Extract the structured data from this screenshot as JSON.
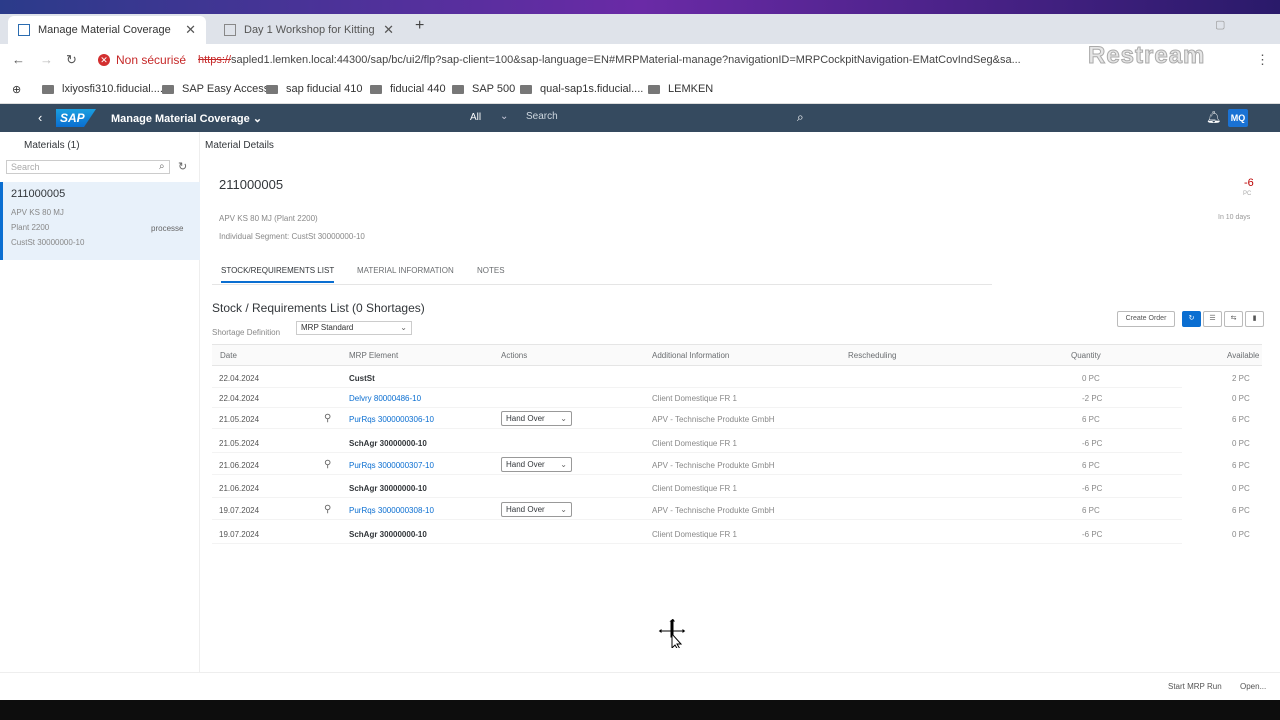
{
  "browser": {
    "tabs": [
      {
        "title": "Manage Material Coverage",
        "active": true
      },
      {
        "title": "Day 1 Workshop for Kitting",
        "active": false
      }
    ],
    "security_label": "Non sécurisé",
    "url_struck": "https://",
    "url_rest": "sapled1.lemken.local:44300/sap/bc/ui2/flp?sap-client=100&sap-language=EN#MRPMaterial-manage?navigationID=MRPCockpitNavigation-EMatCovIndSeg&sa...",
    "watermark": "Restream",
    "bookmarks": [
      "lxiyosfi310.fiducial....",
      "SAP Easy Access",
      "sap fiducial 410",
      "fiducial 440",
      "SAP 500",
      "qual-sap1s.fiducial....",
      "LEMKEN"
    ]
  },
  "shell": {
    "logo": "SAP",
    "app_title": "Manage Material Coverage",
    "search_scope": "All",
    "search_placeholder": "Search",
    "avatar": "MQ"
  },
  "master": {
    "title": "Materials (1)",
    "search_placeholder": "Search",
    "item": {
      "id": "211000005",
      "line1": "APV KS 80 MJ",
      "line2": "Plant 2200",
      "line3": "CustSt 30000000-10",
      "status": "processe"
    }
  },
  "detail": {
    "header_label": "Material Details",
    "material_id": "211000005",
    "sub1": "APV KS 80 MJ (Plant 2200)",
    "sub2": "Individual Segment: CustSt 30000000-10",
    "kpi_value": "-6",
    "kpi_unit": "PC",
    "kpi_right": "In 10 days",
    "tabs": [
      "STOCK/REQUIREMENTS LIST",
      "MATERIAL INFORMATION",
      "NOTES"
    ],
    "section_title": "Stock / Requirements List (0 Shortages)",
    "filter_label": "Shortage Definition",
    "filter_value": "MRP Standard",
    "create_order": "Create Order",
    "columns": [
      "Date",
      "MRP Element",
      "Actions",
      "Additional Information",
      "Rescheduling",
      "Quantity",
      "Available"
    ],
    "rows": [
      {
        "date": "22.04.2024",
        "element": "CustSt",
        "link": false,
        "person": "",
        "action": "",
        "info": "",
        "qty": "0 PC",
        "avail": "2 PC"
      },
      {
        "date": "22.04.2024",
        "element": "Delvry 80000486-10",
        "link": true,
        "person": "",
        "action": "",
        "info": "Client Domestique FR 1",
        "qty": "-2 PC",
        "avail": "0 PC"
      },
      {
        "date": "21.05.2024",
        "element": "PurRqs 3000000306-10",
        "link": true,
        "person": "⚲",
        "action": "Hand Over",
        "info": "APV - Technische Produkte GmbH",
        "qty": "6 PC",
        "avail": "6 PC"
      },
      {
        "date": "21.05.2024",
        "element": "SchAgr 30000000-10",
        "link": false,
        "person": "",
        "action": "",
        "info": "Client Domestique FR 1",
        "qty": "-6 PC",
        "avail": "0 PC"
      },
      {
        "date": "21.06.2024",
        "element": "PurRqs 3000000307-10",
        "link": true,
        "person": "⚲",
        "action": "Hand Over",
        "info": "APV - Technische Produkte GmbH",
        "qty": "6 PC",
        "avail": "6 PC"
      },
      {
        "date": "21.06.2024",
        "element": "SchAgr 30000000-10",
        "link": false,
        "person": "",
        "action": "",
        "info": "Client Domestique FR 1",
        "qty": "-6 PC",
        "avail": "0 PC"
      },
      {
        "date": "19.07.2024",
        "element": "PurRqs 3000000308-10",
        "link": true,
        "person": "⚲",
        "action": "Hand Over",
        "info": "APV - Technische Produkte GmbH",
        "qty": "6 PC",
        "avail": "6 PC"
      },
      {
        "date": "19.07.2024",
        "element": "SchAgr 30000000-10",
        "link": false,
        "person": "",
        "action": "",
        "info": "Client Domestique FR 1",
        "qty": "-6 PC",
        "avail": "0 PC"
      }
    ]
  },
  "footer": {
    "start_mrp": "Start MRP Run",
    "open": "Open..."
  },
  "colors": {
    "shell_bg": "#354a5f",
    "link": "#0a6ed1",
    "negative": "#bb0000"
  }
}
